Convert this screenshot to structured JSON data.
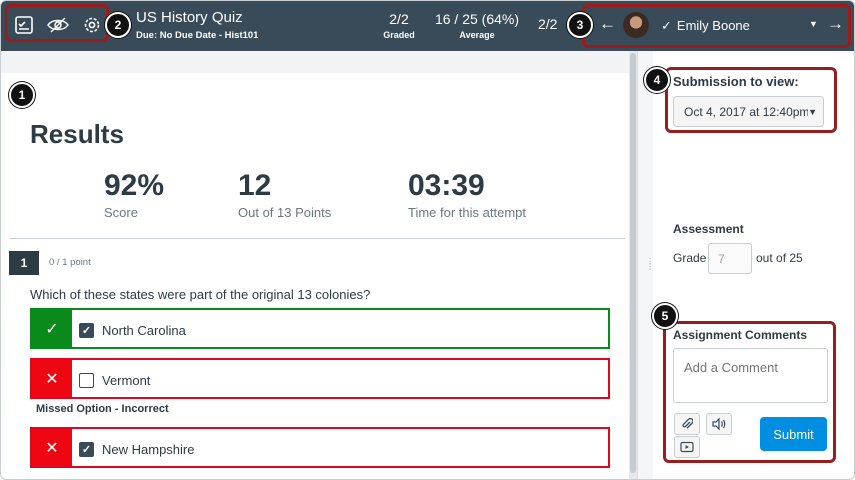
{
  "header": {
    "title": "US History Quiz",
    "due": "Due: No Due Date - Hist101",
    "graded_value": "2/2",
    "graded_label": "Graded",
    "average_value": "16 / 25 (64%)",
    "average_label": "Average",
    "student_count": "2/2",
    "student_name": "Emily Boone",
    "prev_arrow": "←",
    "next_arrow": "→",
    "check_glyph": "✓",
    "caret": "▼",
    "icons": [
      "gradebook-icon",
      "eye-slash-icon",
      "gear-icon"
    ]
  },
  "callouts": [
    "1",
    "2",
    "3",
    "4",
    "5"
  ],
  "results": {
    "title": "Results",
    "metrics": [
      {
        "value": "92%",
        "label": "Score"
      },
      {
        "value": "12",
        "label": "Out of 13 Points"
      },
      {
        "value": "03:39",
        "label": "Time for this attempt"
      }
    ]
  },
  "question": {
    "number": "1",
    "points": "0 / 1 point",
    "text": "Which of these states were part of the original 13 colonies?",
    "answers": [
      {
        "text": "North Carolina",
        "status": "correct",
        "checked": true,
        "mark": "✓"
      },
      {
        "text": "Vermont",
        "status": "incorrect",
        "checked": false,
        "mark": "✕"
      },
      {
        "text": "New Hampshire",
        "status": "incorrect",
        "checked": true,
        "mark": "✕"
      }
    ],
    "missed_note": "Missed Option - Incorrect"
  },
  "sidebar": {
    "submission_label": "Submission to view:",
    "submission_value": "Oct 4, 2017 at 12:40pm",
    "assessment_label": "Assessment",
    "grade_label": "Grade",
    "grade_placeholder": "7",
    "grade_out_of": "out of 25",
    "comments_label": "Assignment Comments",
    "comment_placeholder": "Add a Comment",
    "submit_label": "Submit",
    "tools": [
      "paperclip-icon",
      "speaker-icon",
      "video-icon"
    ]
  },
  "colors": {
    "header_bg": "#394b58",
    "correct": "#0b8a1c",
    "incorrect": "#ee0612",
    "callout": "#9b1c1c",
    "submit": "#008ee2"
  }
}
